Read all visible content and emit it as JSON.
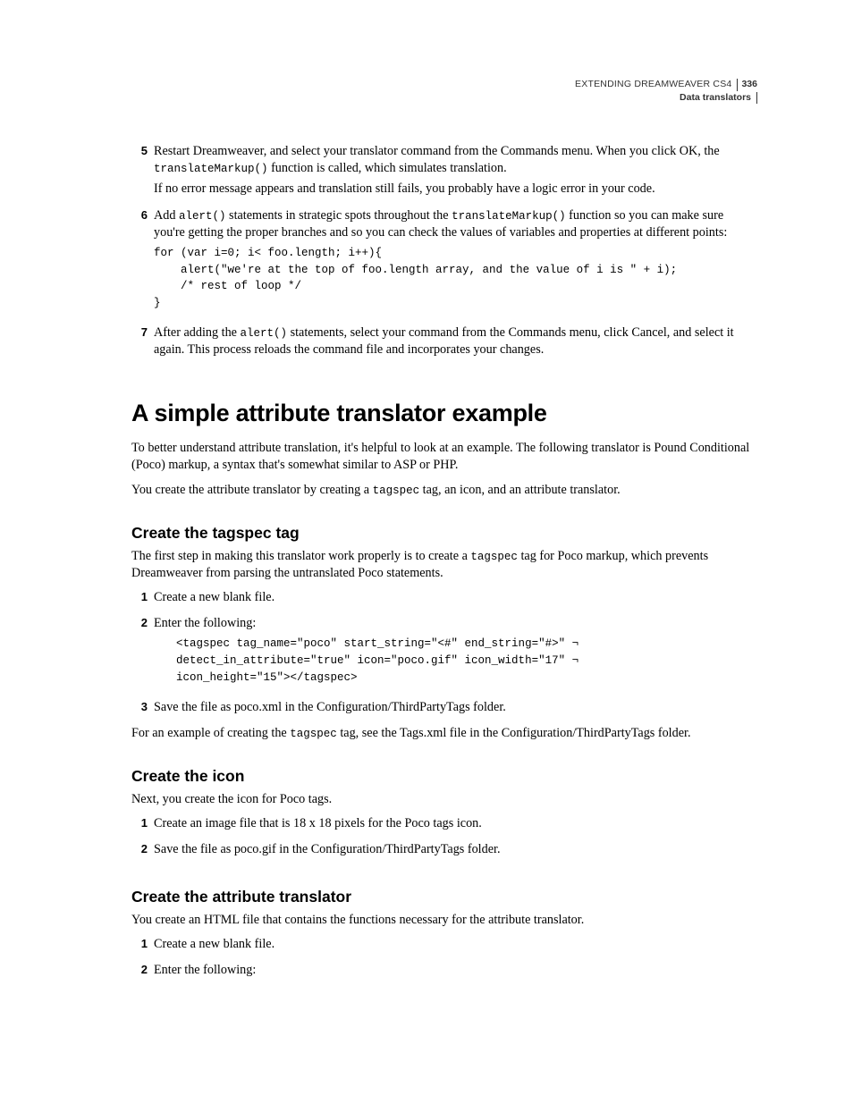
{
  "header": {
    "doc_title": "EXTENDING DREAMWEAVER CS4",
    "page_number": "336",
    "section": "Data translators"
  },
  "step5": {
    "num": "5",
    "line1a": "Restart Dreamweaver, and select your translator command from the Commands menu. When you click OK, the ",
    "code1": "translateMarkup()",
    "line1b": " function is called, which simulates translation.",
    "line2": "If no error message appears and translation still fails, you probably have a logic error in your code."
  },
  "step6": {
    "num": "6",
    "line1a": "Add ",
    "code1": "alert()",
    "line1b": " statements in strategic spots throughout the ",
    "code2": "translateMarkup()",
    "line1c": " function so you can make sure you're getting the proper branches and so you can check the values of variables and properties at different points:",
    "code_block": "for (var i=0; i< foo.length; i++){\n    alert(\"we're at the top of foo.length array, and the value of i is \" + i);\n    /* rest of loop */\n}"
  },
  "step7": {
    "num": "7",
    "line1a": "After adding the ",
    "code1": "alert()",
    "line1b": " statements, select your command from the Commands menu, click Cancel, and select it again. This process reloads the command file and incorporates your changes."
  },
  "main": {
    "heading": "A simple attribute translator example",
    "intro1": "To better understand attribute translation, it's helpful to look at an example. The following translator is Pound Conditional (Poco) markup, a syntax that's somewhat similar to ASP or PHP.",
    "intro2a": "You create the attribute translator by creating a ",
    "intro2_code": "tagspec",
    "intro2b": " tag, an icon, and an attribute translator."
  },
  "tagspec": {
    "heading": "Create the tagspec tag",
    "intro_a": "The first step in making this translator work properly is to create a ",
    "intro_code": "tagspec",
    "intro_b": " tag for Poco markup, which prevents Dreamweaver from parsing the untranslated Poco statements.",
    "s1_num": "1",
    "s1": "Create a new blank file.",
    "s2_num": "2",
    "s2": "Enter the following:",
    "code_block": "<tagspec tag_name=\"poco\" start_string=\"<#\" end_string=\"#>\" ¬\ndetect_in_attribute=\"true\" icon=\"poco.gif\" icon_width=\"17\" ¬\nicon_height=\"15\"></tagspec>",
    "s3_num": "3",
    "s3": "Save the file as poco.xml in the Configuration/ThirdPartyTags folder.",
    "note_a": "For an example of creating the ",
    "note_code": "tagspec",
    "note_b": " tag, see the Tags.xml file in the Configuration/ThirdPartyTags folder."
  },
  "icon": {
    "heading": "Create the icon",
    "intro": "Next, you create the icon for Poco tags.",
    "s1_num": "1",
    "s1": "Create an image file that is 18 x 18 pixels for the Poco tags icon.",
    "s2_num": "2",
    "s2": "Save the file as poco.gif in the Configuration/ThirdPartyTags folder."
  },
  "attr": {
    "heading": "Create the attribute translator",
    "intro": "You create an HTML file that contains the functions necessary for the attribute translator.",
    "s1_num": "1",
    "s1": "Create a new blank file.",
    "s2_num": "2",
    "s2": "Enter the following:"
  }
}
